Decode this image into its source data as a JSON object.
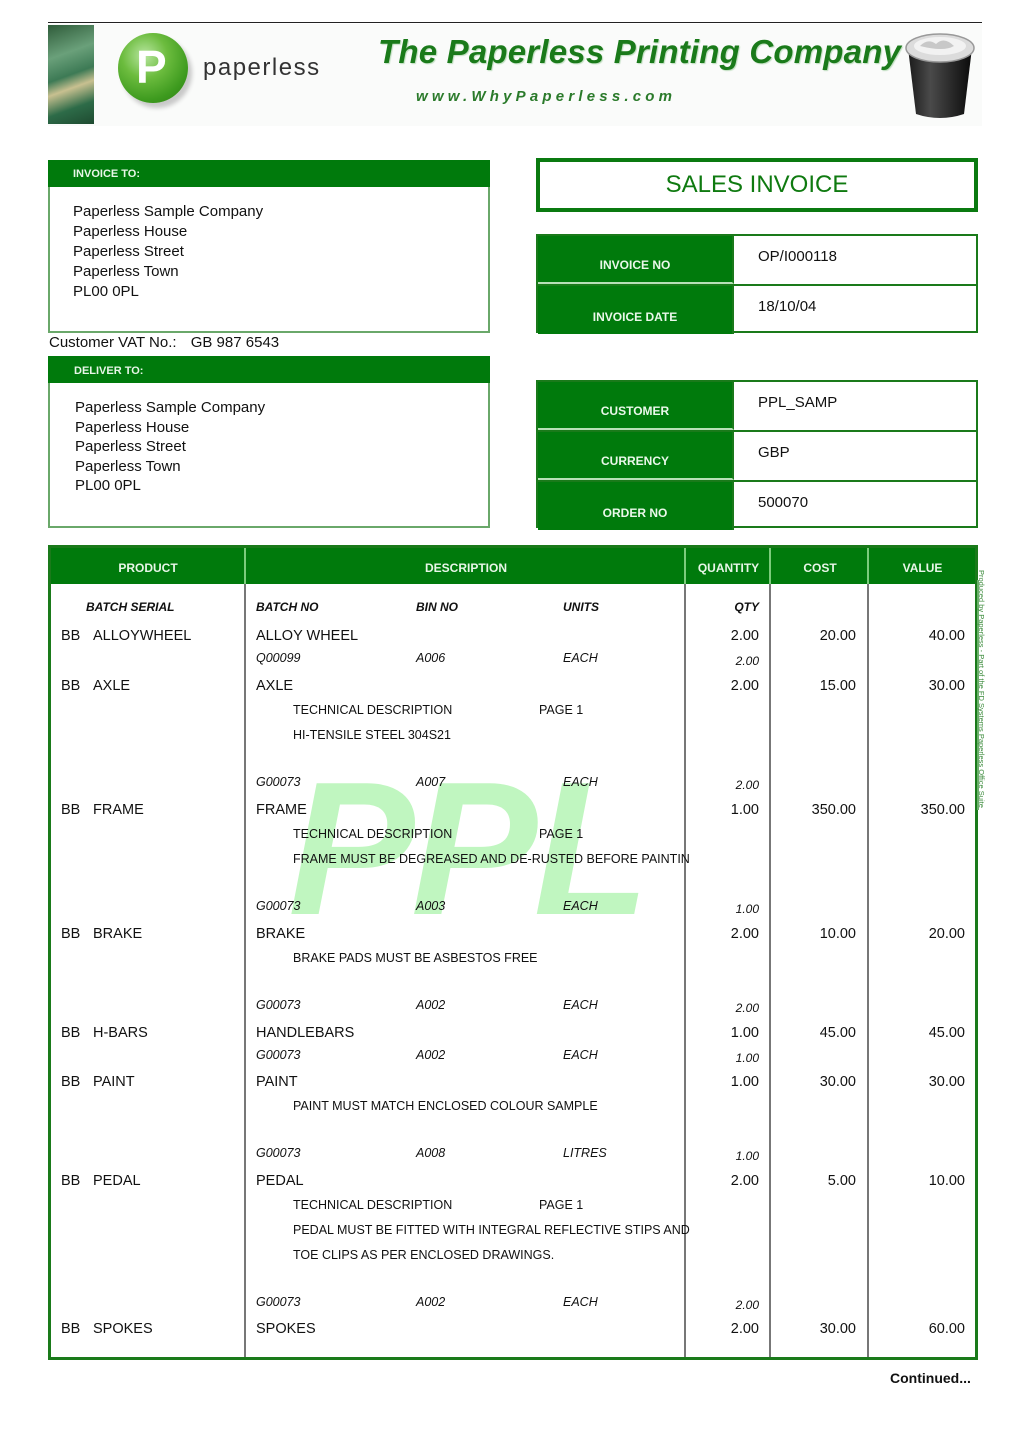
{
  "header": {
    "logo_letter": "P",
    "logo_word": "paperless",
    "company_name": "The Paperless Printing Company",
    "website": "www.WhyPaperless.com"
  },
  "invoice_to": {
    "label": "INVOICE TO:",
    "lines": [
      "Paperless Sample Company",
      "Paperless House",
      "Paperless Street",
      "Paperless Town",
      "PL00 0PL"
    ]
  },
  "vat": {
    "label": "Customer VAT No.:",
    "value": "GB 987 6543"
  },
  "deliver_to": {
    "label": "DELIVER TO:",
    "lines": [
      "Paperless Sample Company",
      "Paperless House",
      "Paperless Street",
      "Paperless Town",
      "PL00 0PL"
    ]
  },
  "document_title": "SALES INVOICE",
  "invoice_info": [
    {
      "label": "INVOICE NO",
      "value": "OP/I000118"
    },
    {
      "label": "INVOICE DATE",
      "value": "18/10/04"
    }
  ],
  "order_info": [
    {
      "label": "CUSTOMER",
      "value": "PPL_SAMP"
    },
    {
      "label": "CURRENCY",
      "value": "GBP"
    },
    {
      "label": "ORDER NO",
      "value": "500070"
    }
  ],
  "table": {
    "headers": {
      "product": "PRODUCT",
      "description": "DESCRIPTION",
      "quantity": "QUANTITY",
      "cost": "COST",
      "value": "VALUE"
    },
    "subheaders": {
      "batch_serial": "BATCH SERIAL",
      "batch_no": "BATCH NO",
      "bin_no": "BIN NO",
      "units": "UNITS",
      "qty": "QTY"
    },
    "rows": [
      {
        "prefix": "BB",
        "code": "ALLOYWHEEL",
        "description": "ALLOY WHEEL",
        "quantity": "2.00",
        "cost": "20.00",
        "value": "40.00",
        "notes": [],
        "batch": {
          "batch_no": "Q00099",
          "bin_no": "A006",
          "units": "EACH",
          "qty": "2.00"
        }
      },
      {
        "prefix": "BB",
        "code": "AXLE",
        "description": "AXLE",
        "quantity": "2.00",
        "cost": "15.00",
        "value": "30.00",
        "notes": [
          {
            "text": "TECHNICAL DESCRIPTION",
            "page": "PAGE 1"
          },
          {
            "text": "HI-TENSILE STEEL 304S21",
            "page": ""
          }
        ],
        "batch": {
          "batch_no": "G00073",
          "bin_no": "A007",
          "units": "EACH",
          "qty": "2.00"
        }
      },
      {
        "prefix": "BB",
        "code": "FRAME",
        "description": "FRAME",
        "quantity": "1.00",
        "cost": "350.00",
        "value": "350.00",
        "notes": [
          {
            "text": "TECHNICAL DESCRIPTION",
            "page": "PAGE 1"
          },
          {
            "text": "FRAME MUST BE DEGREASED AND DE-RUSTED BEFORE PAINTIN",
            "page": ""
          }
        ],
        "batch": {
          "batch_no": "G00073",
          "bin_no": "A003",
          "units": "EACH",
          "qty": "1.00"
        }
      },
      {
        "prefix": "BB",
        "code": "BRAKE",
        "description": "BRAKE",
        "quantity": "2.00",
        "cost": "10.00",
        "value": "20.00",
        "notes": [
          {
            "text": "BRAKE PADS MUST BE ASBESTOS FREE",
            "page": ""
          }
        ],
        "batch": {
          "batch_no": "G00073",
          "bin_no": "A002",
          "units": "EACH",
          "qty": "2.00"
        }
      },
      {
        "prefix": "BB",
        "code": "H-BARS",
        "description": "HANDLEBARS",
        "quantity": "1.00",
        "cost": "45.00",
        "value": "45.00",
        "notes": [],
        "batch": {
          "batch_no": "G00073",
          "bin_no": "A002",
          "units": "EACH",
          "qty": "1.00"
        }
      },
      {
        "prefix": "BB",
        "code": "PAINT",
        "description": "PAINT",
        "quantity": "1.00",
        "cost": "30.00",
        "value": "30.00",
        "notes": [
          {
            "text": "PAINT MUST MATCH ENCLOSED COLOUR SAMPLE",
            "page": ""
          }
        ],
        "batch": {
          "batch_no": "G00073",
          "bin_no": "A008",
          "units": "LITRES",
          "qty": "1.00"
        }
      },
      {
        "prefix": "BB",
        "code": "PEDAL",
        "description": "PEDAL",
        "quantity": "2.00",
        "cost": "5.00",
        "value": "10.00",
        "notes": [
          {
            "text": "TECHNICAL DESCRIPTION",
            "page": "PAGE 1"
          },
          {
            "text": "PEDAL MUST BE FITTED WITH INTEGRAL REFLECTIVE STIPS AND",
            "page": ""
          },
          {
            "text": "TOE CLIPS AS PER ENCLOSED DRAWINGS.",
            "page": ""
          }
        ],
        "batch": {
          "batch_no": "G00073",
          "bin_no": "A002",
          "units": "EACH",
          "qty": "2.00"
        }
      },
      {
        "prefix": "BB",
        "code": "SPOKES",
        "description": "SPOKES",
        "quantity": "2.00",
        "cost": "30.00",
        "value": "60.00",
        "notes": [],
        "batch": null
      }
    ]
  },
  "watermark": "PPL",
  "side_note": "Produced by Paperless - Part of the FD Systems Paperless Office Suite",
  "continued": "Continued..."
}
